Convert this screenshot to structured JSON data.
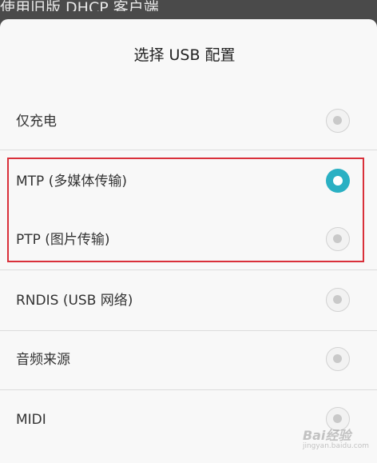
{
  "background_title": "使用旧版 DHCP 客户端",
  "dialog": {
    "title": "选择 USB 配置"
  },
  "options": [
    {
      "label": "仅充电",
      "selected": false
    },
    {
      "label": "MTP (多媒体传输)",
      "selected": true
    },
    {
      "label": "PTP (图片传输)",
      "selected": false
    },
    {
      "label": "RNDIS (USB 网络)",
      "selected": false
    },
    {
      "label": "音频来源",
      "selected": false
    },
    {
      "label": "MIDI",
      "selected": false
    }
  ],
  "watermark": {
    "brand": "Bai经验",
    "url": "jingyan.baidu.com"
  },
  "colors": {
    "accent": "#2ab0c3",
    "highlight": "#d9303a"
  }
}
